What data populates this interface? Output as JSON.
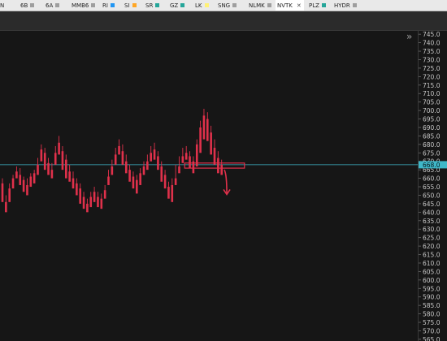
{
  "tabs": [
    {
      "label": "N",
      "color": ""
    },
    {
      "label": "6B",
      "color": "#9e9e9e"
    },
    {
      "label": "6A",
      "color": "#9e9e9e"
    },
    {
      "label": "MMB6",
      "color": "#9e9e9e"
    },
    {
      "label": "RI",
      "color": "#2196f3"
    },
    {
      "label": "SI",
      "color": "#ffa726"
    },
    {
      "label": "SR",
      "color": "#26a69a"
    },
    {
      "label": "GZ",
      "color": "#26a69a"
    },
    {
      "label": "LK",
      "color": "#fff176"
    },
    {
      "label": "SNG",
      "color": "#9e9e9e"
    },
    {
      "label": "NLMK",
      "color": "#9e9e9e"
    },
    {
      "label": "NVTK",
      "color": "",
      "active": true,
      "close": "✕"
    },
    {
      "label": "PLZ",
      "color": "#26a69a"
    },
    {
      "label": "HYDR",
      "color": "#9e9e9e"
    }
  ],
  "collapse_glyph": "»",
  "chart_data": {
    "type": "candlestick",
    "ylim": [
      564,
      747
    ],
    "tick_labels": [
      "745.0",
      "740.0",
      "735.0",
      "730.0",
      "725.0",
      "720.0",
      "715.0",
      "710.0",
      "705.0",
      "700.0",
      "695.0",
      "690.0",
      "685.0",
      "680.0",
      "675.0",
      "670.0",
      "665.0",
      "660.0",
      "655.0",
      "650.0",
      "645.0",
      "640.0",
      "635.0",
      "630.0",
      "625.0",
      "620.0",
      "615.0",
      "610.0",
      "605.0",
      "600.0",
      "595.0",
      "590.0",
      "585.0",
      "580.0",
      "575.0",
      "570.0",
      "565.0"
    ],
    "tick_values": [
      745,
      740,
      735,
      730,
      725,
      720,
      715,
      710,
      705,
      700,
      695,
      690,
      685,
      680,
      675,
      670,
      665,
      660,
      655,
      650,
      645,
      640,
      635,
      630,
      625,
      620,
      615,
      610,
      605,
      600,
      595,
      590,
      585,
      580,
      575,
      570,
      565
    ],
    "current_price": 668.0,
    "current_price_label": "668.0",
    "up_color": "#26c6da",
    "down_color": "#e0314b",
    "candles": [
      [
        657,
        660,
        648,
        646
      ],
      [
        646,
        650,
        643,
        640
      ],
      [
        654,
        657,
        650,
        646
      ],
      [
        660,
        662,
        658,
        654
      ],
      [
        664,
        667,
        662,
        660
      ],
      [
        662,
        666,
        659,
        656
      ],
      [
        659,
        661,
        654,
        652
      ],
      [
        656,
        660,
        653,
        650
      ],
      [
        661,
        663,
        658,
        655
      ],
      [
        663,
        665,
        660,
        657
      ],
      [
        668,
        672,
        665,
        662
      ],
      [
        677,
        680,
        674,
        670
      ],
      [
        675,
        678,
        668,
        665
      ],
      [
        669,
        672,
        665,
        662
      ],
      [
        665,
        669,
        663,
        660
      ],
      [
        675,
        679,
        672,
        668
      ],
      [
        681,
        685,
        677,
        674
      ],
      [
        676,
        679,
        668,
        665
      ],
      [
        671,
        674,
        664,
        660
      ],
      [
        664,
        668,
        661,
        658
      ],
      [
        660,
        664,
        656,
        654
      ],
      [
        657,
        660,
        653,
        650
      ],
      [
        654,
        657,
        647,
        645
      ],
      [
        649,
        652,
        645,
        642
      ],
      [
        645,
        648,
        642,
        640
      ],
      [
        649,
        652,
        645,
        643
      ],
      [
        652,
        655,
        648,
        646
      ],
      [
        649,
        652,
        645,
        643
      ],
      [
        648,
        651,
        644,
        642
      ],
      [
        653,
        656,
        650,
        648
      ],
      [
        661,
        665,
        658,
        656
      ],
      [
        667,
        671,
        664,
        662
      ],
      [
        674,
        678,
        670,
        668
      ],
      [
        679,
        683,
        676,
        674
      ],
      [
        676,
        680,
        670,
        668
      ],
      [
        670,
        674,
        665,
        663
      ],
      [
        665,
        668,
        660,
        658
      ],
      [
        661,
        664,
        657,
        654
      ],
      [
        659,
        662,
        654,
        651
      ],
      [
        663,
        666,
        659,
        656
      ],
      [
        667,
        670,
        664,
        662
      ],
      [
        670,
        674,
        667,
        665
      ],
      [
        675,
        679,
        672,
        670
      ],
      [
        677,
        681,
        674,
        671
      ],
      [
        673,
        676,
        667,
        665
      ],
      [
        667,
        670,
        661,
        658
      ],
      [
        662,
        665,
        657,
        654
      ],
      [
        655,
        658,
        650,
        648
      ],
      [
        656,
        660,
        648,
        646
      ],
      [
        660,
        668,
        658,
        656
      ],
      [
        667,
        673,
        665,
        663
      ],
      [
        673,
        678,
        671,
        669
      ],
      [
        675,
        679,
        673,
        671
      ],
      [
        673,
        676,
        668,
        666
      ],
      [
        670,
        673,
        665,
        663
      ],
      [
        680,
        683,
        670,
        667
      ],
      [
        690,
        694,
        677,
        675
      ],
      [
        697,
        701,
        685,
        683
      ],
      [
        695,
        699,
        684,
        682
      ],
      [
        687,
        691,
        676,
        674
      ],
      [
        678,
        683,
        670,
        668
      ],
      [
        672,
        676,
        666,
        663
      ],
      [
        668,
        671,
        664,
        662
      ]
    ],
    "annotation_box": {
      "x_from": 52,
      "x_to": 68,
      "y_from": 666,
      "y_to": 669
    },
    "annotation_arrow": {
      "x": 63,
      "y_from": 665,
      "y_to": 651
    }
  }
}
